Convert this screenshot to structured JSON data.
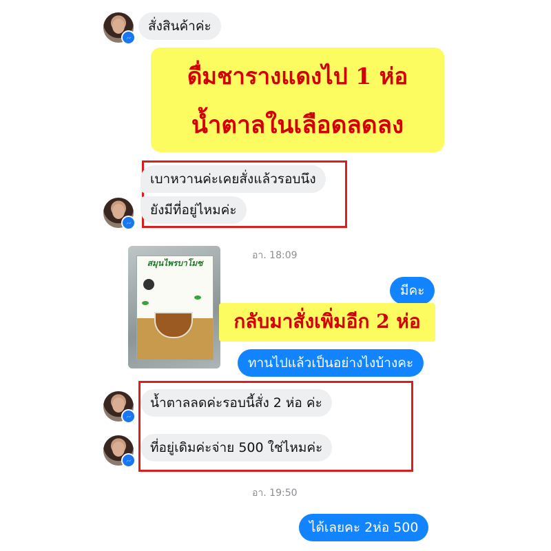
{
  "messages": {
    "m1": "สั่งสินค้าค่ะ",
    "m2": "เบาหวานค่ะเคยสั่งแล้วรอบนึง",
    "m3": "ยังมีที่อยู่ไหมค่ะ",
    "m4": "มีคะ",
    "m5": "ทานไปแล้วเป็นอย่างไงบ้างคะ",
    "m6": "น้ำตาลลดค่ะรอบนี้สั่ง 2 ห่อ ค่ะ",
    "m7": "ที่อยู่เดิมค่ะจ่าย 500 ใช่ไหมค่ะ",
    "m8": "ได้เลยคะ 2ห่อ 500"
  },
  "overlay": {
    "line1": "ดื่มชารางแดงไป 1 ห่อ",
    "line2": "น้ำตาลในเลือดลดลง",
    "line3": "กลับมาสั่งเพิ่มอีก 2 ห่อ"
  },
  "timestamps": {
    "t1": "อา. 18:09",
    "t2": "อา. 19:50"
  },
  "product": {
    "title": "สมุนไพรบาโมซ"
  },
  "colors": {
    "outgoing": "#1384ff",
    "incoming": "#eeeff1",
    "highlight": "#fcfc60",
    "overlay_text": "#d40000",
    "frame": "#d91e1e",
    "messenger_badge": "#1877f2"
  }
}
